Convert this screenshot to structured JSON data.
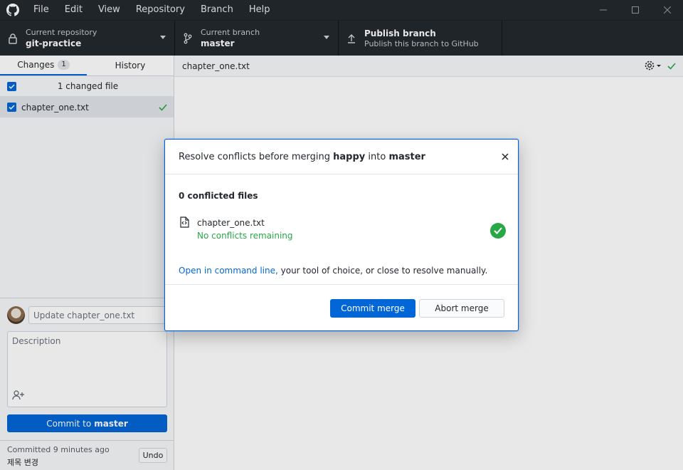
{
  "menu": [
    "File",
    "Edit",
    "View",
    "Repository",
    "Branch",
    "Help"
  ],
  "toolbar": {
    "repo_label": "Current repository",
    "repo_value": "git-practice",
    "branch_label": "Current branch",
    "branch_value": "master",
    "publish_label": "Publish branch",
    "publish_desc": "Publish this branch to GitHub"
  },
  "sidebar": {
    "tab_changes": "Changes",
    "tab_changes_count": "1",
    "tab_history": "History",
    "changed_files": "1 changed file",
    "files": [
      "chapter_one.txt"
    ]
  },
  "commit": {
    "summary_placeholder": "Update chapter_one.txt",
    "description_placeholder": "Description",
    "button_prefix": "Commit to",
    "button_branch": "master"
  },
  "last_commit": {
    "time": "Committed 9 minutes ago",
    "message": "제목 변경",
    "undo": "Undo"
  },
  "diff": {
    "filename": "chapter_one.txt"
  },
  "dialog": {
    "title_prefix": "Resolve conflicts before merging",
    "source_branch": "happy",
    "title_mid": "into",
    "target_branch": "master",
    "subtitle": "0 conflicted files",
    "file_name": "chapter_one.txt",
    "file_status": "No conflicts remaining",
    "hint_link": "Open in command line,",
    "hint_rest": " your tool of choice, or close to resolve manually.",
    "commit_button": "Commit merge",
    "abort_button": "Abort merge"
  },
  "colors": {
    "accent": "#0366d6",
    "success": "#28a745",
    "dark_chrome": "#24292e"
  }
}
